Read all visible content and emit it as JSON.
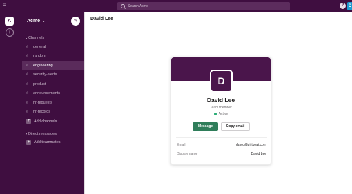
{
  "topbar": {
    "menu_icon": "≡",
    "search_placeholder": "Search Acme",
    "help_icon": "?",
    "avatar_letter": "D"
  },
  "rail": {
    "workspace_letter": "A",
    "add_icon": "+"
  },
  "sidebar": {
    "workspace_name": "Acme",
    "workspace_chevron": "⌄",
    "compose_icon": "✎",
    "channels_header": "Channels",
    "channels": [
      {
        "name": "general"
      },
      {
        "name": "random"
      },
      {
        "name": "engineering"
      },
      {
        "name": "security-alerts"
      },
      {
        "name": "product"
      },
      {
        "name": "announcements"
      },
      {
        "name": "hr-requests"
      },
      {
        "name": "hr-records"
      }
    ],
    "add_channels": "Add channels",
    "dm_header": "Direct messages",
    "add_teammates": "Add teammates"
  },
  "main": {
    "title": "David Lee"
  },
  "profile": {
    "initial": "D",
    "name": "David Lee",
    "role": "Team member",
    "status": "Active",
    "message_button": "Message",
    "copy_email_button": "Copy email",
    "email_label": "Email",
    "email_value": "david@virtueai.com",
    "display_name_label": "Display name",
    "display_name_value": "David Lee"
  },
  "colors": {
    "aubergine": "#3f0e40",
    "banner": "#4a154b",
    "message_green": "#2f7d5a",
    "status_green": "#2bac76"
  }
}
